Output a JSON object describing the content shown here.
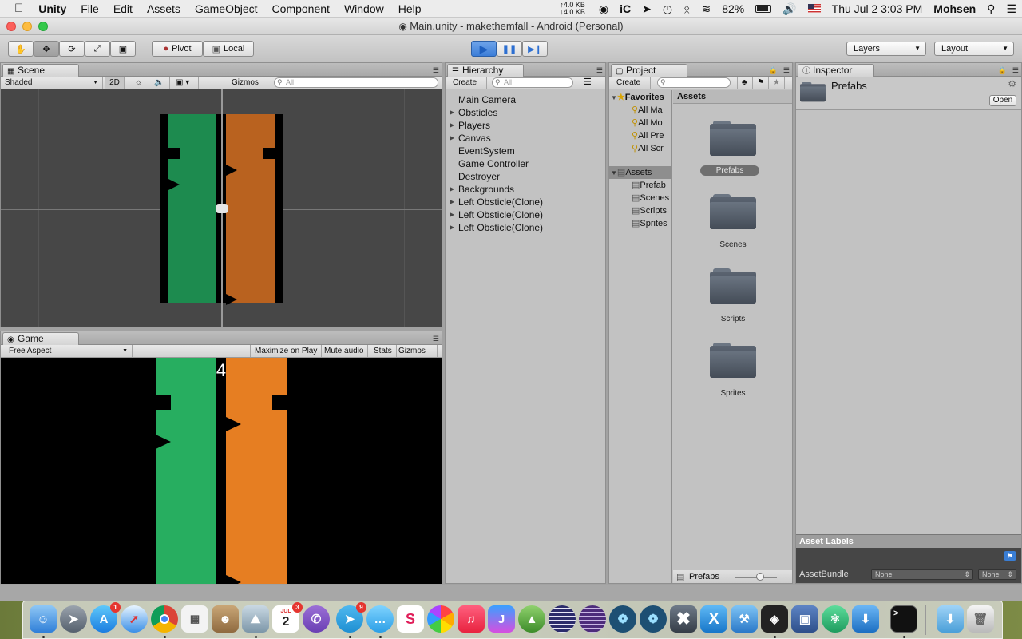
{
  "menubar": {
    "app": "Unity",
    "items": [
      "File",
      "Edit",
      "Assets",
      "GameObject",
      "Component",
      "Window",
      "Help"
    ],
    "net_up": "↑4.0 KB",
    "net_down": "↓4.0 KB",
    "battery": "82%",
    "clock": "Thu Jul 2  3:03 PM",
    "user": "Mohsen"
  },
  "window": {
    "title": "Main.unity - makethemfall - Android (Personal)"
  },
  "toolbar": {
    "pivot": "Pivot",
    "local": "Local",
    "layers": "Layers",
    "layout": "Layout"
  },
  "scene": {
    "tab": "Scene",
    "shading": "Shaded",
    "mode_2d": "2D",
    "gizmos": "Gizmos",
    "search_placeholder": "All"
  },
  "game": {
    "tab": "Game",
    "aspect": "Free Aspect",
    "maximize": "Maximize on Play",
    "mute": "Mute audio",
    "stats": "Stats",
    "gizmos": "Gizmos",
    "score": "4"
  },
  "hierarchy": {
    "tab": "Hierarchy",
    "create": "Create",
    "search_placeholder": "All",
    "items": [
      {
        "label": "Main Camera",
        "expandable": false
      },
      {
        "label": "Obsticles",
        "expandable": true
      },
      {
        "label": "Players",
        "expandable": true
      },
      {
        "label": "Canvas",
        "expandable": true
      },
      {
        "label": "EventSystem",
        "expandable": false
      },
      {
        "label": "Game Controller",
        "expandable": false
      },
      {
        "label": "Destroyer",
        "expandable": false
      },
      {
        "label": "Backgrounds",
        "expandable": true
      },
      {
        "label": "Left Obsticle(Clone)",
        "expandable": true
      },
      {
        "label": "Left Obsticle(Clone)",
        "expandable": true
      },
      {
        "label": "Left Obsticle(Clone)",
        "expandable": true
      }
    ]
  },
  "project": {
    "tab": "Project",
    "create": "Create",
    "favorites": "Favorites",
    "favorite_items": [
      "All Ma",
      "All Mo",
      "All Pre",
      "All Scr"
    ],
    "assets_root": "Assets",
    "asset_tree": [
      "Prefab",
      "Scenes",
      "Scripts",
      "Sprites"
    ],
    "grid_header": "Assets",
    "folders": [
      "Prefabs",
      "Scenes",
      "Scripts",
      "Sprites"
    ],
    "selected_folder": "Prefabs",
    "footer": "Prefabs"
  },
  "inspector": {
    "tab": "Inspector",
    "object": "Prefabs",
    "open": "Open",
    "asset_labels": "Asset Labels",
    "assetbundle": "AssetBundle",
    "bundle_value": "None",
    "variant_value": "None"
  },
  "dock": {
    "badges": {
      "appstore": "1",
      "calendar": "3",
      "telegram": "9"
    },
    "calendar_month": "JUL",
    "calendar_day": "2"
  },
  "colors": {
    "green_scene": "#1d8b4f",
    "orange_scene": "#b9621f",
    "green_game": "#27ae60",
    "orange_game": "#e67e22",
    "play_active": "#3b7dd8"
  }
}
